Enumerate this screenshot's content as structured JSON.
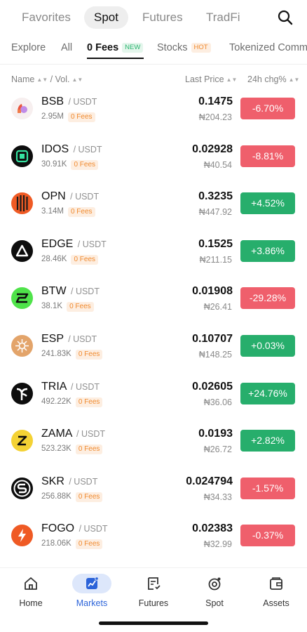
{
  "top_tabs": [
    {
      "label": "Favorites",
      "active": false
    },
    {
      "label": "Spot",
      "active": true
    },
    {
      "label": "Futures",
      "active": false
    },
    {
      "label": "TradFi",
      "active": false
    }
  ],
  "sub_tabs": [
    {
      "label": "Explore",
      "badge": ""
    },
    {
      "label": "All",
      "badge": ""
    },
    {
      "label": "0 Fees",
      "badge": "NEW",
      "active": true
    },
    {
      "label": "Stocks",
      "badge": "HOT"
    },
    {
      "label": "Tokenized Comm",
      "badge": ""
    }
  ],
  "columns": {
    "name": "Name",
    "vol": "/ Vol.",
    "price": "Last Price",
    "change": "24h chg%"
  },
  "colors": {
    "up": "#27ae6c",
    "down": "#ef5f6c",
    "accent": "#2b63d9"
  },
  "rows": [
    {
      "symbol": "BSB",
      "quote": "/ USDT",
      "volume": "2.95M",
      "fee_tag": "0 Fees",
      "price": "0.1475",
      "fiat": "₦204.23",
      "change": "-6.70%",
      "direction": "down",
      "icon": "bsb-logo-icon"
    },
    {
      "symbol": "IDOS",
      "quote": "/ USDT",
      "volume": "30.91K",
      "fee_tag": "0 Fees",
      "price": "0.02928",
      "fiat": "₦40.54",
      "change": "-8.81%",
      "direction": "down",
      "icon": "idos-logo-icon"
    },
    {
      "symbol": "OPN",
      "quote": "/ USDT",
      "volume": "3.14M",
      "fee_tag": "0 Fees",
      "price": "0.3235",
      "fiat": "₦447.92",
      "change": "+4.52%",
      "direction": "up",
      "icon": "opn-logo-icon"
    },
    {
      "symbol": "EDGE",
      "quote": "/ USDT",
      "volume": "28.46K",
      "fee_tag": "0 Fees",
      "price": "0.1525",
      "fiat": "₦211.15",
      "change": "+3.86%",
      "direction": "up",
      "icon": "edge-logo-icon"
    },
    {
      "symbol": "BTW",
      "quote": "/ USDT",
      "volume": "38.1K",
      "fee_tag": "0 Fees",
      "price": "0.01908",
      "fiat": "₦26.41",
      "change": "-29.28%",
      "direction": "down",
      "icon": "btw-logo-icon"
    },
    {
      "symbol": "ESP",
      "quote": "/ USDT",
      "volume": "241.83K",
      "fee_tag": "0 Fees",
      "price": "0.10707",
      "fiat": "₦148.25",
      "change": "+0.03%",
      "direction": "up",
      "icon": "esp-logo-icon"
    },
    {
      "symbol": "TRIA",
      "quote": "/ USDT",
      "volume": "492.22K",
      "fee_tag": "0 Fees",
      "price": "0.02605",
      "fiat": "₦36.06",
      "change": "+24.76%",
      "direction": "up",
      "icon": "tria-logo-icon"
    },
    {
      "symbol": "ZAMA",
      "quote": "/ USDT",
      "volume": "523.23K",
      "fee_tag": "0 Fees",
      "price": "0.0193",
      "fiat": "₦26.72",
      "change": "+2.82%",
      "direction": "up",
      "icon": "zama-logo-icon"
    },
    {
      "symbol": "SKR",
      "quote": "/ USDT",
      "volume": "256.88K",
      "fee_tag": "0 Fees",
      "price": "0.024794",
      "fiat": "₦34.33",
      "change": "-1.57%",
      "direction": "down",
      "icon": "skr-logo-icon"
    },
    {
      "symbol": "FOGO",
      "quote": "/ USDT",
      "volume": "218.06K",
      "fee_tag": "0 Fees",
      "price": "0.02383",
      "fiat": "₦32.99",
      "change": "-0.37%",
      "direction": "down",
      "icon": "fogo-logo-icon"
    }
  ],
  "bottom_nav": [
    {
      "label": "Home",
      "icon": "home-icon",
      "active": false
    },
    {
      "label": "Markets",
      "icon": "markets-icon",
      "active": true
    },
    {
      "label": "Futures",
      "icon": "futures-icon",
      "active": false
    },
    {
      "label": "Spot",
      "icon": "spot-icon",
      "active": false
    },
    {
      "label": "Assets",
      "icon": "wallet-icon",
      "active": false
    }
  ]
}
